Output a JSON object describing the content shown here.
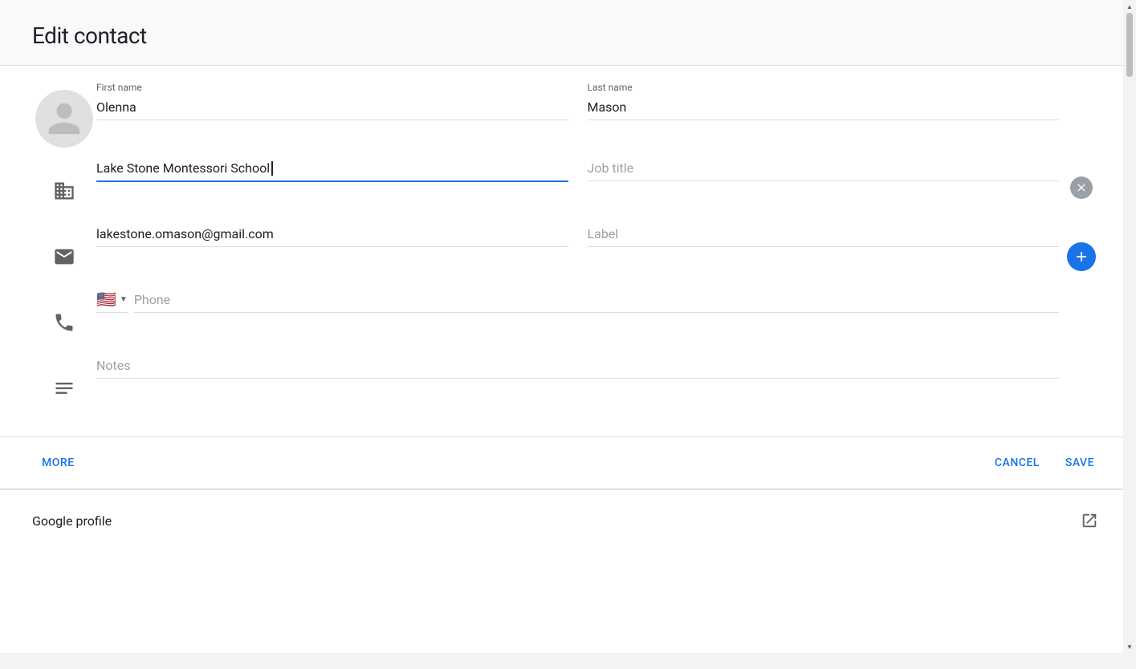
{
  "dialog": {
    "title": "Edit contact",
    "avatar_alt": "Contact avatar"
  },
  "form": {
    "first_name_label": "First name",
    "first_name_value": "Olenna",
    "last_name_label": "Last name",
    "last_name_value": "Mason",
    "company_value": "Lake Stone Montessori School",
    "job_title_placeholder": "Job title",
    "email_value": "lakestone.omason@gmail.com",
    "label_placeholder": "Label",
    "phone_placeholder": "Phone",
    "notes_placeholder": "Notes"
  },
  "footer": {
    "more_label": "MORE",
    "cancel_label": "CANCEL",
    "save_label": "SAVE"
  },
  "google_profile": {
    "title": "Google profile"
  },
  "scroll": {
    "up_arrow": "▲",
    "down_arrow": "▼"
  }
}
